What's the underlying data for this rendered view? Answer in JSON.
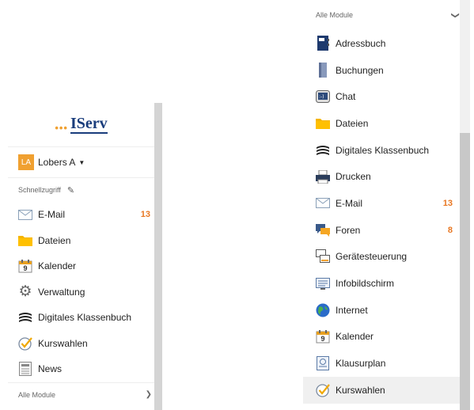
{
  "left_sidebar": {
    "logo_text": "IServ",
    "user": {
      "initials": "LA",
      "name": "Lobers A"
    },
    "quick_access_label": "Schnellzugriff",
    "items": [
      {
        "label": "E-Mail",
        "icon": "mail-icon",
        "badge": "13"
      },
      {
        "label": "Dateien",
        "icon": "folder-icon"
      },
      {
        "label": "Kalender",
        "icon": "calendar-icon",
        "icon_text": "9"
      },
      {
        "label": "Verwaltung",
        "icon": "gear-icon"
      },
      {
        "label": "Digitales Klassenbuch",
        "icon": "books-icon"
      },
      {
        "label": "Kurswahlen",
        "icon": "check-icon"
      },
      {
        "label": "News",
        "icon": "news-icon"
      }
    ],
    "all_modules_label": "Alle Module"
  },
  "right_panel": {
    "all_modules_label": "Alle Module",
    "items": [
      {
        "label": "Adressbuch",
        "icon": "address-book-icon"
      },
      {
        "label": "Buchungen",
        "icon": "booking-icon"
      },
      {
        "label": "Chat",
        "icon": "chat-icon"
      },
      {
        "label": "Dateien",
        "icon": "folder-icon"
      },
      {
        "label": "Digitales Klassenbuch",
        "icon": "books-icon"
      },
      {
        "label": "Drucken",
        "icon": "printer-icon"
      },
      {
        "label": "E-Mail",
        "icon": "mail-icon",
        "badge": "13"
      },
      {
        "label": "Foren",
        "icon": "forum-icon",
        "badge": "8"
      },
      {
        "label": "Gerätesteuerung",
        "icon": "device-control-icon"
      },
      {
        "label": "Infobildschirm",
        "icon": "info-screen-icon"
      },
      {
        "label": "Internet",
        "icon": "globe-icon"
      },
      {
        "label": "Kalender",
        "icon": "calendar-icon",
        "icon_text": "9"
      },
      {
        "label": "Klausurplan",
        "icon": "exam-plan-icon"
      },
      {
        "label": "Kurswahlen",
        "icon": "check-icon",
        "active": true
      }
    ]
  },
  "colors": {
    "accent": "#f0a030",
    "badge": "#e87722",
    "logo": "#1a3d7c"
  }
}
